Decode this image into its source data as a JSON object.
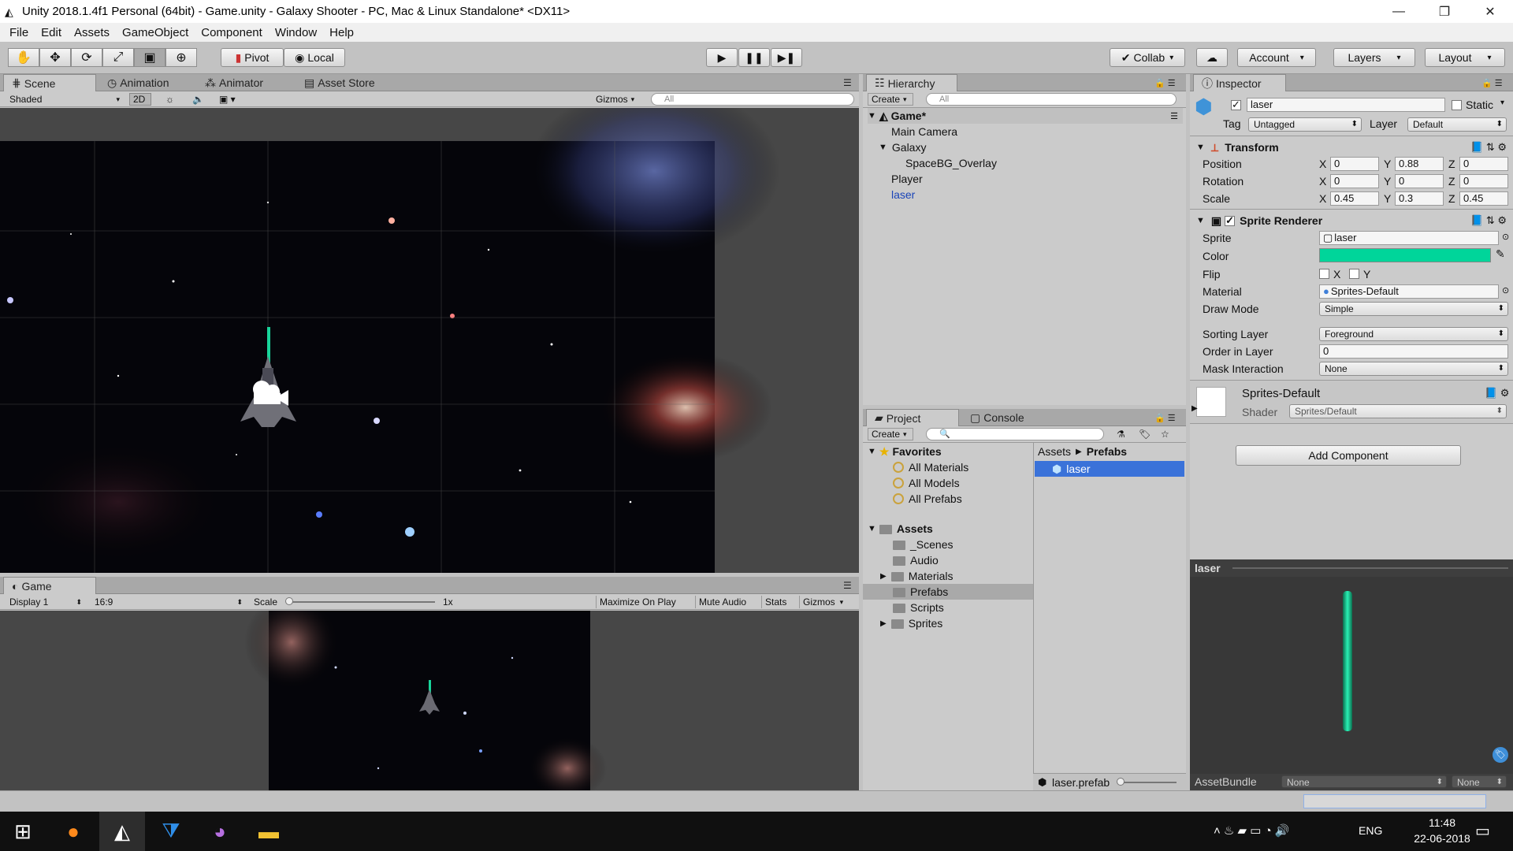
{
  "window": {
    "title": "Unity 2018.1.4f1 Personal (64bit) - Game.unity - Galaxy Shooter - PC, Mac & Linux Standalone* <DX11>",
    "minimize": "—",
    "maximize": "❐",
    "close": "✕"
  },
  "menu": [
    "File",
    "Edit",
    "Assets",
    "GameObject",
    "Component",
    "Window",
    "Help"
  ],
  "toolbar": {
    "pivot": "Pivot",
    "local": "Local",
    "collab": "Collab",
    "account": "Account",
    "layers": "Layers",
    "layout": "Layout"
  },
  "scene": {
    "tabs": [
      "Scene",
      "Animation",
      "Animator",
      "Asset Store"
    ],
    "shading": "Shaded",
    "mode_2d": "2D",
    "gizmos": "Gizmos",
    "search_placeholder": "All"
  },
  "game": {
    "tab": "Game",
    "display": "Display 1",
    "aspect": "16:9",
    "scale_label": "Scale",
    "scale_value": "1x",
    "maximize": "Maximize On Play",
    "mute": "Mute Audio",
    "stats": "Stats",
    "gizmos": "Gizmos"
  },
  "hierarchy": {
    "tab": "Hierarchy",
    "create": "Create",
    "search_placeholder": "All",
    "scene_name": "Game*",
    "items": [
      "Main Camera",
      "Galaxy",
      "SpaceBG_Overlay",
      "Player",
      "laser"
    ]
  },
  "project": {
    "tabs": [
      "Project",
      "Console"
    ],
    "create": "Create",
    "favorites_label": "Favorites",
    "favorites": [
      "All Materials",
      "All Models",
      "All Prefabs"
    ],
    "assets_label": "Assets",
    "folders": [
      "_Scenes",
      "Audio",
      "Materials",
      "Prefabs",
      "Scripts",
      "Sprites"
    ],
    "breadcrumb": [
      "Assets",
      "Prefabs"
    ],
    "selected_asset": "laser",
    "footer_file": "laser.prefab"
  },
  "inspector": {
    "tab": "Inspector",
    "object_name": "laser",
    "static_label": "Static",
    "tag_label": "Tag",
    "tag": "Untagged",
    "layer_label": "Layer",
    "layer": "Default",
    "transform": {
      "title": "Transform",
      "position_label": "Position",
      "rotation_label": "Rotation",
      "scale_label": "Scale",
      "position": [
        "0",
        "0.88",
        "0"
      ],
      "rotation": [
        "0",
        "0",
        "0"
      ],
      "scale": [
        "0.45",
        "0.3",
        "0.45"
      ]
    },
    "sprite_renderer": {
      "title": "Sprite Renderer",
      "sprite_label": "Sprite",
      "sprite": "laser",
      "color_label": "Color",
      "color": "#00d59a",
      "flip_label": "Flip",
      "flip_x": "X",
      "flip_y": "Y",
      "material_label": "Material",
      "material": "Sprites-Default",
      "draw_mode_label": "Draw Mode",
      "draw_mode": "Simple",
      "sorting_layer_label": "Sorting Layer",
      "sorting_layer": "Foreground",
      "order_label": "Order in Layer",
      "order": "0",
      "mask_label": "Mask Interaction",
      "mask": "None"
    },
    "material_block": {
      "name": "Sprites-Default",
      "shader_label": "Shader",
      "shader": "Sprites/Default"
    },
    "add_component": "Add Component",
    "preview_title": "laser",
    "assetbundle_label": "AssetBundle",
    "assetbundle": "None",
    "assetbundle_variant": "None"
  },
  "taskbar": {
    "lang": "ENG",
    "time": "11:48",
    "date": "22-06-2018"
  }
}
